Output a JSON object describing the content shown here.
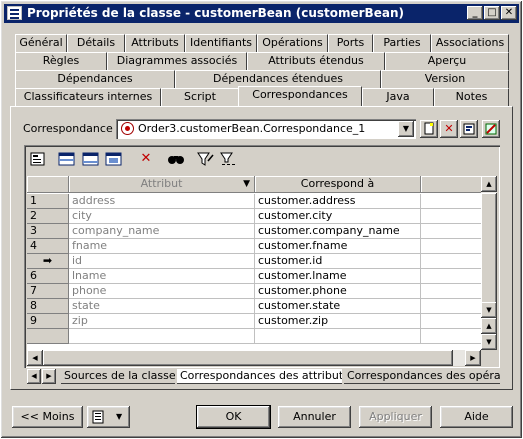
{
  "window": {
    "title": "Propriétés de la classe - customerBean (customerBean)",
    "minimize": "_",
    "maximize": "□",
    "close": "✕"
  },
  "tabs": {
    "row1": [
      "Général",
      "Détails",
      "Attributs",
      "Identifiants",
      "Opérations",
      "Ports",
      "Parties",
      "Associations"
    ],
    "row2": [
      "Règles",
      "Diagrammes associés",
      "Attributs étendus",
      "Aperçu"
    ],
    "row3": [
      "Dépendances",
      "Dépendances étendues",
      "Version"
    ],
    "row4": [
      "Classificateurs internes",
      "Script",
      "Correspondances",
      "Java",
      "Notes"
    ],
    "active": "Correspondances"
  },
  "mapping": {
    "label": "Correspondance :",
    "value": "Order3.customerBean.Correspondance_1"
  },
  "table": {
    "columns": [
      "Attribut",
      "Correspond à"
    ],
    "rows": [
      {
        "num": "1",
        "attribute": "address",
        "maps_to": "customer.address"
      },
      {
        "num": "2",
        "attribute": "city",
        "maps_to": "customer.city"
      },
      {
        "num": "3",
        "attribute": "company_name",
        "maps_to": "customer.company_name"
      },
      {
        "num": "4",
        "attribute": "fname",
        "maps_to": "customer.fname"
      },
      {
        "num": "➡",
        "attribute": "id",
        "maps_to": "customer.id"
      },
      {
        "num": "6",
        "attribute": "lname",
        "maps_to": "customer.lname"
      },
      {
        "num": "7",
        "attribute": "phone",
        "maps_to": "customer.phone"
      },
      {
        "num": "8",
        "attribute": "state",
        "maps_to": "customer.state"
      },
      {
        "num": "9",
        "attribute": "zip",
        "maps_to": "customer.zip"
      }
    ]
  },
  "sheets": [
    "Sources de la classe",
    "Correspondances des attributs",
    "Correspondances des opération"
  ],
  "active_sheet": "Correspondances des attributs",
  "buttons": {
    "less": "<< Moins",
    "ok": "OK",
    "cancel": "Annuler",
    "apply": "Appliquer",
    "help": "Aide"
  },
  "colors": {
    "titlebar": "#0a246a",
    "face": "#d4d0c8",
    "delete_icon": "#c00000"
  }
}
